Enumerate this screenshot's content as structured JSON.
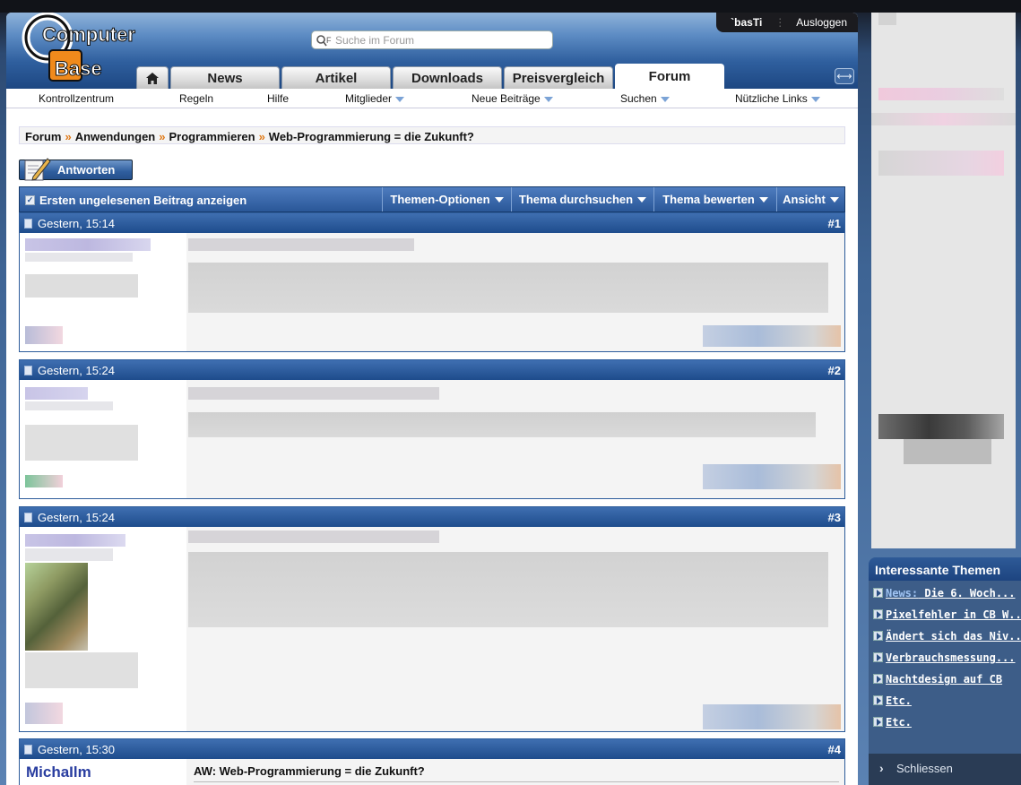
{
  "header": {
    "logo_line1": "Computer",
    "logo_line2": "Base",
    "search_placeholder": "Suche im Forum",
    "username": "`basTi",
    "logout": "Ausloggen",
    "tabs": [
      "News",
      "Artikel",
      "Downloads",
      "Preisvergleich",
      "Forum"
    ],
    "active_tab": "Forum"
  },
  "subnav": [
    "Kontrollzentrum",
    "Regeln",
    "Hilfe",
    "Mitglieder",
    "Neue Beiträge",
    "Suchen",
    "Nützliche Links"
  ],
  "breadcrumb": [
    "Forum",
    "Anwendungen",
    "Programmieren",
    "Web-Programmierung = die Zukunft?"
  ],
  "reply_button": "Antworten",
  "toolbar": {
    "first_unread": "Ersten ungelesenen Beitrag anzeigen",
    "options": "Themen-Optionen",
    "search": "Thema durchsuchen",
    "rate": "Thema bewerten",
    "view": "Ansicht"
  },
  "posts": [
    {
      "date": "Gestern, 15:14",
      "number": "#1"
    },
    {
      "date": "Gestern, 15:24",
      "number": "#2"
    },
    {
      "date": "Gestern, 15:24",
      "number": "#3"
    },
    {
      "date": "Gestern, 15:30",
      "number": "#4",
      "author": "MichaIlm",
      "title": "AW: Web-Programmierung = die Zukunft?"
    }
  ],
  "sidebar": {
    "title": "Interessante Themen",
    "items": [
      {
        "prefix": "News:",
        "text": " Die 6. Woch..."
      },
      {
        "prefix": "",
        "text": "Pixelfehler in CB W..."
      },
      {
        "prefix": "",
        "text": "Ändert sich das Niv..."
      },
      {
        "prefix": "",
        "text": "Verbrauchsmessung..."
      },
      {
        "prefix": "",
        "text": "Nachtdesign auf CB"
      },
      {
        "prefix": "",
        "text": "Etc."
      },
      {
        "prefix": "",
        "text": "Etc."
      }
    ],
    "close": "Schliessen"
  }
}
